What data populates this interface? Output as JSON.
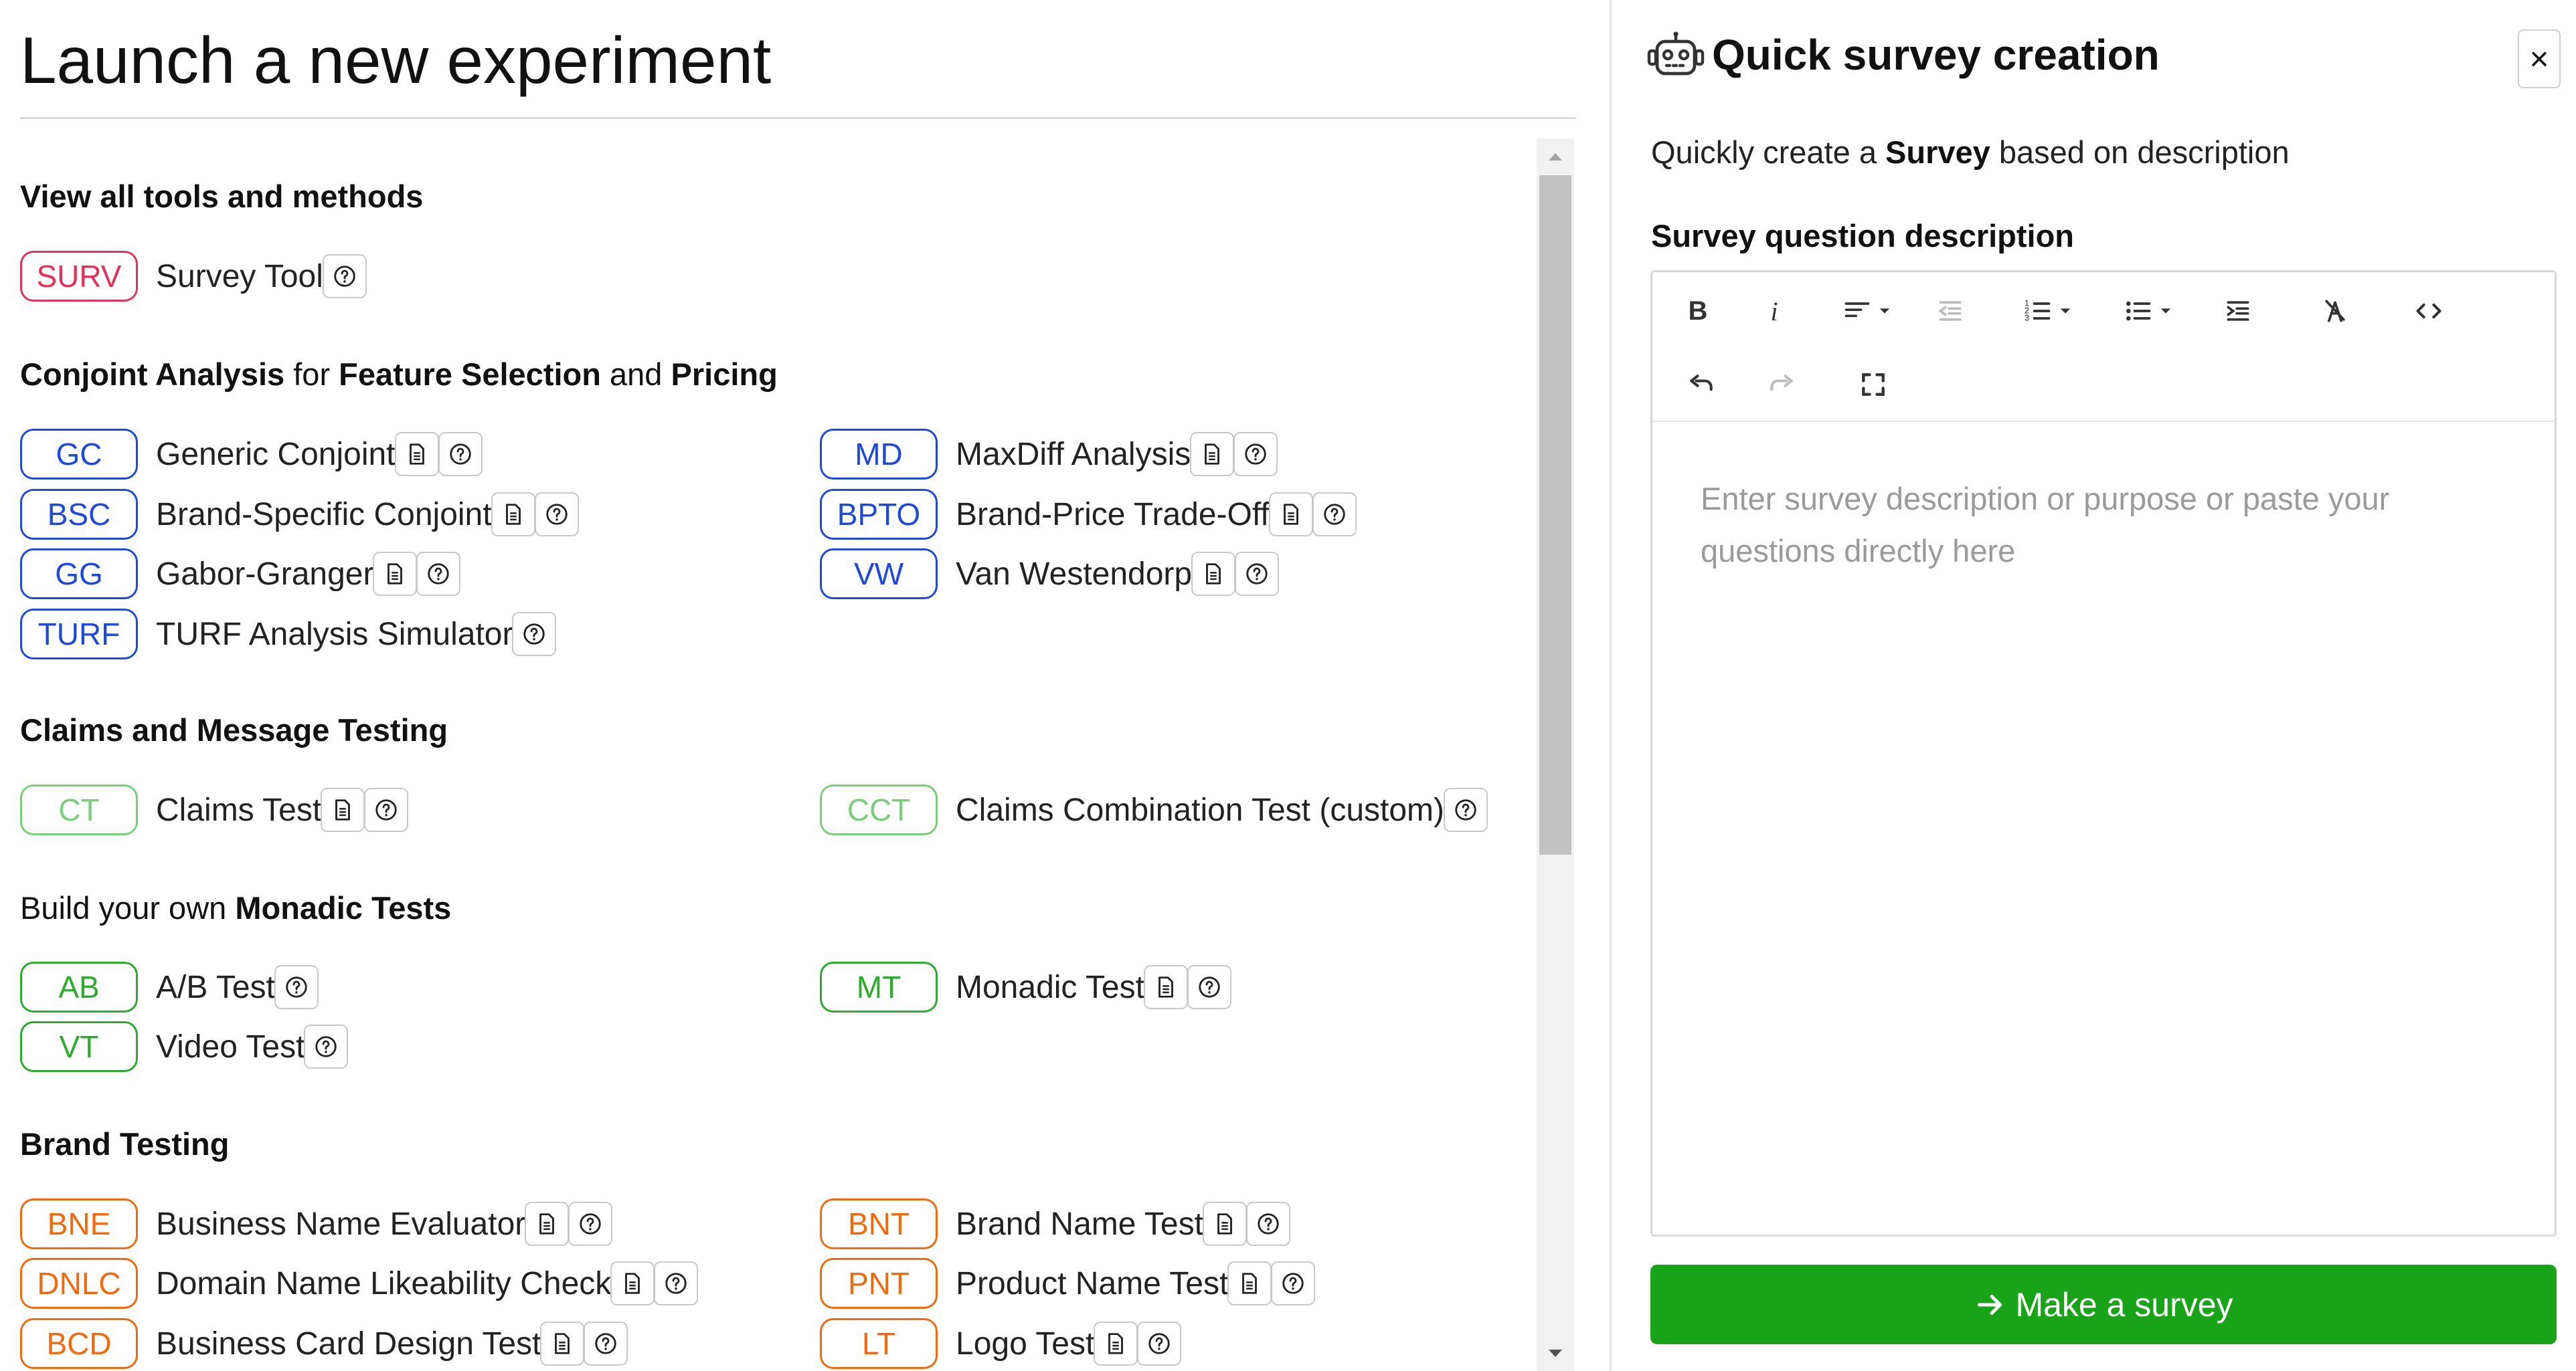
{
  "page": {
    "title": "Launch a new experiment"
  },
  "sections": {
    "all_tools": "View all tools and methods",
    "conjoint": {
      "t1": "Conjoint Analysis",
      "t2": " for ",
      "t3": "Feature Selection",
      "t4": " and ",
      "t5": "Pricing"
    },
    "claims": "Claims and Message Testing",
    "monadic": {
      "t1": "Build your own ",
      "t2": "Monadic Tests"
    },
    "brand": "Brand Testing"
  },
  "tools": {
    "surv": {
      "code": "SURV",
      "name": "Survey Tool"
    },
    "gc": {
      "code": "GC",
      "name": "Generic Conjoint"
    },
    "md": {
      "code": "MD",
      "name": "MaxDiff Analysis"
    },
    "bsc": {
      "code": "BSC",
      "name": "Brand-Specific Conjoint"
    },
    "bpto": {
      "code": "BPTO",
      "name": "Brand-Price Trade-Off"
    },
    "gg": {
      "code": "GG",
      "name": "Gabor-Granger"
    },
    "vw": {
      "code": "VW",
      "name": "Van Westendorp"
    },
    "turf": {
      "code": "TURF",
      "name": "TURF Analysis Simulator"
    },
    "ct": {
      "code": "CT",
      "name": "Claims Test"
    },
    "cct": {
      "code": "CCT",
      "name": "Claims Combination Test (custom)"
    },
    "ab": {
      "code": "AB",
      "name": "A/B Test"
    },
    "mt": {
      "code": "MT",
      "name": "Monadic Test"
    },
    "vt": {
      "code": "VT",
      "name": "Video Test"
    },
    "bne": {
      "code": "BNE",
      "name": "Business Name Evaluator"
    },
    "bnt": {
      "code": "BNT",
      "name": "Brand Name Test"
    },
    "dnlc": {
      "code": "DNLC",
      "name": "Domain Name Likeability Check"
    },
    "pnt": {
      "code": "PNT",
      "name": "Product Name Test"
    },
    "bcd": {
      "code": "BCD",
      "name": "Business Card Design Test"
    },
    "lt": {
      "code": "LT",
      "name": "Logo Test"
    }
  },
  "panel": {
    "title": "Quick survey creation",
    "close": "×",
    "subtitle": {
      "t1": "Quickly create a ",
      "t2": "Survey",
      "t3": " based on description"
    },
    "field_label": "Survey question description",
    "toolbar": {
      "bold": "B",
      "italic": "i"
    },
    "placeholder": "Enter survey description or purpose or paste your questions directly here",
    "submit": "Make a survey"
  },
  "colors": {
    "pink": "#e0325a",
    "blue": "#1f49d6",
    "green": "#2eaa2e",
    "light_green": "#7acd7a",
    "orange": "#f06a10",
    "primary_button": "#19a319"
  },
  "icons": [
    "doc-icon",
    "help-icon",
    "robot-icon",
    "close-icon",
    "arrow-right-icon"
  ]
}
